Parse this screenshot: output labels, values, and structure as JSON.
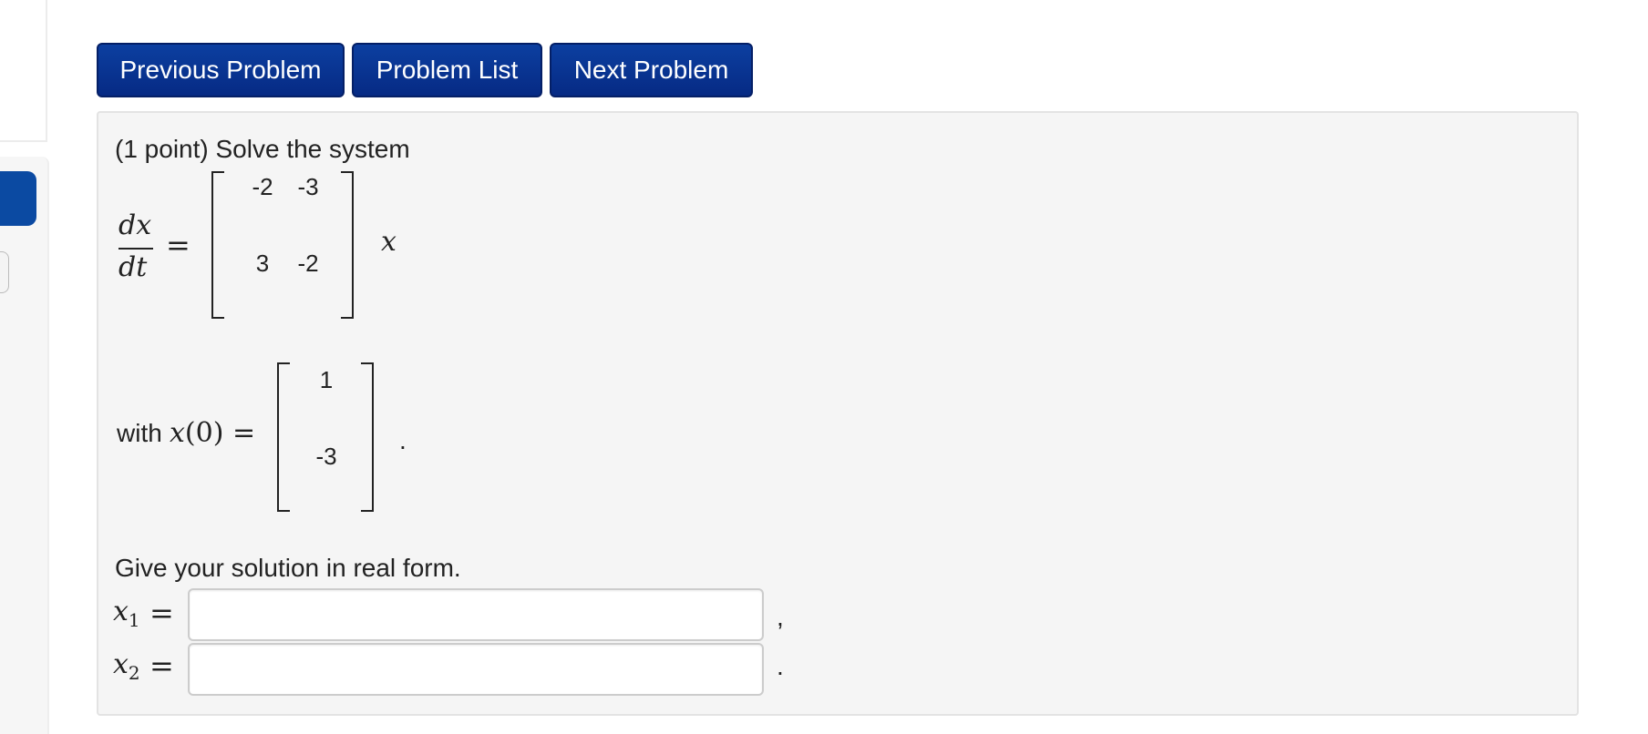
{
  "nav": {
    "previous_label": "Previous Problem",
    "list_label": "Problem List",
    "next_label": "Next Problem"
  },
  "problem": {
    "intro": "(1 point) Solve the system",
    "derivative_num": "dx",
    "derivative_den": "dt",
    "equals": "=",
    "variable": "x",
    "matrix_A": [
      [
        "-2",
        "-3"
      ],
      [
        "3",
        "-2"
      ]
    ],
    "initial_label": "with",
    "initial_math": "x(0)",
    "initial_vector": [
      "1",
      "-3"
    ],
    "initial_terminator": ".",
    "instruction": "Give your solution in real form.",
    "answers": [
      {
        "label_base": "x",
        "label_sub": "1",
        "value": "",
        "separator": ","
      },
      {
        "label_base": "x",
        "label_sub": "2",
        "value": "",
        "separator": "."
      }
    ]
  },
  "colors": {
    "button_bg": "#062a84",
    "panel_bg": "#f5f5f5",
    "sidebar_accent": "#0b4aa2"
  }
}
